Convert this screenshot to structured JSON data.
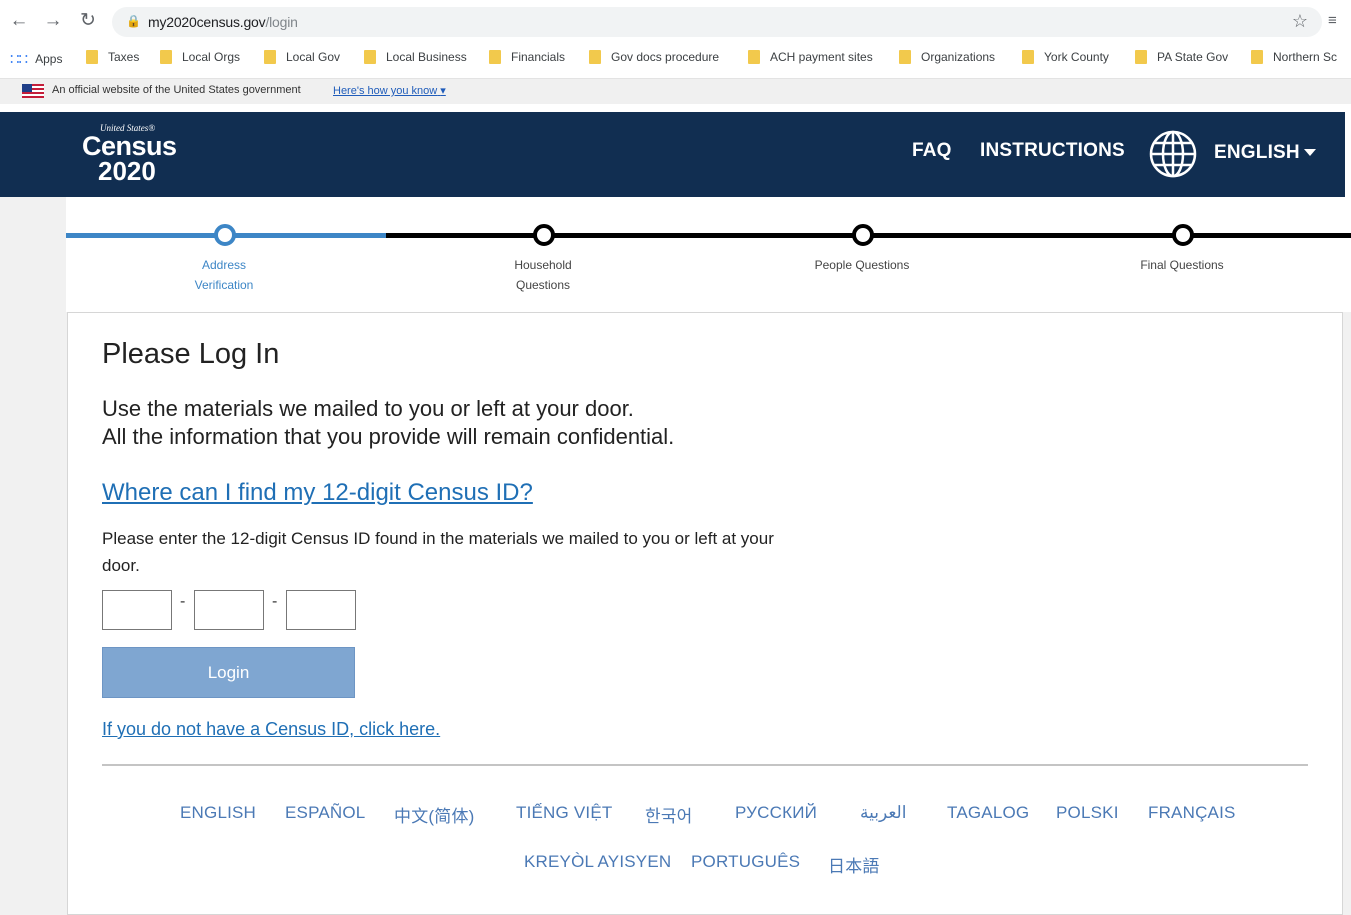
{
  "browser": {
    "back_icon": "arrow-left-icon",
    "forward_icon": "arrow-right-icon",
    "reload_icon": "reload-icon",
    "url_host": "my2020census.gov",
    "url_path": "/login",
    "bookmarks": [
      {
        "label": "Apps",
        "icon": "apps-grid-icon"
      },
      {
        "label": "Taxes"
      },
      {
        "label": "Local Orgs"
      },
      {
        "label": "Local Gov"
      },
      {
        "label": "Local Business"
      },
      {
        "label": "Financials"
      },
      {
        "label": "Gov docs procedure"
      },
      {
        "label": "ACH payment sites"
      },
      {
        "label": "Organizations"
      },
      {
        "label": "York County"
      },
      {
        "label": "PA State Gov"
      },
      {
        "label": "Northern Sc"
      }
    ]
  },
  "gov_banner": {
    "text": "An official website of the United States government",
    "link": "Here's how you know"
  },
  "header": {
    "logo_small": "United States®",
    "logo_big": "Census",
    "logo_year": "2020",
    "faq": "FAQ",
    "instructions": "INSTRUCTIONS",
    "language": "ENGLISH",
    "accent_color": "#112e51"
  },
  "progress": {
    "steps": [
      {
        "line1": "Address",
        "line2": "Verification",
        "active": true
      },
      {
        "line1": "Household",
        "line2": "Questions",
        "active": false
      },
      {
        "line1": "People Questions",
        "line2": "",
        "active": false
      },
      {
        "line1": "Final Questions",
        "line2": "",
        "active": false
      }
    ],
    "active_color": "#3d86c6"
  },
  "login": {
    "title": "Please Log In",
    "intro_line1": "Use the materials we mailed to you or left at your door.",
    "intro_line2": "All the information that you provide will remain confidential.",
    "find_id_link": "Where can I find my 12-digit Census ID?",
    "instructions": "Please enter the 12-digit Census ID found in the materials we mailed to you or left at your door.",
    "id_part1": "",
    "id_part2": "",
    "id_part3": "",
    "dash": "-",
    "button": "Login",
    "no_id_link": "If you do not have a Census ID, click here."
  },
  "languages": {
    "row1": [
      "ENGLISH",
      "ESPAÑOL",
      "中文(简体)",
      "TIẾNG VIỆT",
      "한국어",
      "РУССКИЙ",
      "العربية",
      "TAGALOG",
      "POLSKI",
      "FRANÇAIS"
    ],
    "row2": [
      "KREYÒL AYISYEN",
      "PORTUGUÊS",
      "日本語"
    ]
  }
}
